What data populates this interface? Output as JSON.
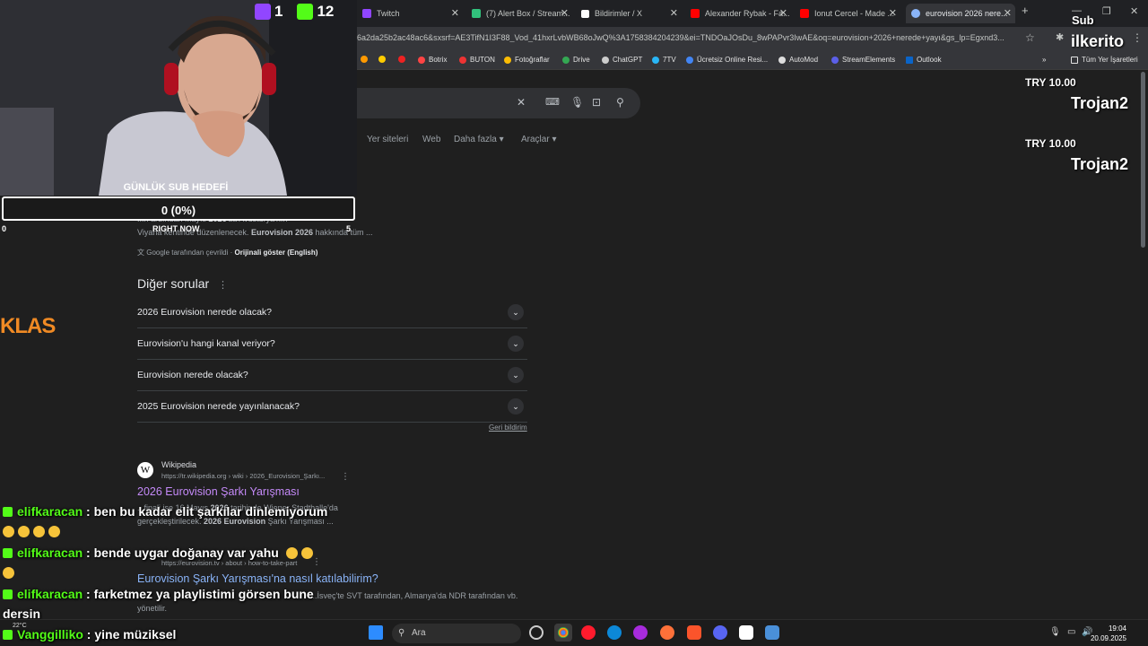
{
  "browser": {
    "tabs": [
      {
        "label": "Twitch",
        "color": "#9146ff"
      },
      {
        "label": "(7) Alert Box / Stream...",
        "color": "#31c27c"
      },
      {
        "label": "Bildirimler / X",
        "color": "#ffffff"
      },
      {
        "label": "Alexander Rybak - Fa...",
        "color": "#ff0000"
      },
      {
        "label": "Ionut Cercel - Made ...",
        "color": "#ff0000"
      },
      {
        "label": "eurovision 2026 nere...",
        "color": "#8ab4f8"
      }
    ],
    "new_tab": "+",
    "url": "6a2da25b2ac48ac6&sxsrf=AE3TifN1I3F88_Vod_41hxrLvbWB68oJwQ%3A1758384204239&ei=TNDOaJOsDu_8wPAPvr3IwAE&oq=eurovision+2026+nerede+yayı&gs_lp=Egxnd3...",
    "bookmarks": [
      {
        "label": "Botrix",
        "color": "#f44"
      },
      {
        "label": "BUTON",
        "color": "#e33"
      },
      {
        "label": "Fotoğraflar",
        "color": "#fbbc04"
      },
      {
        "label": "Drive",
        "color": "#34a853"
      },
      {
        "label": "ChatGPT",
        "color": "#ccc"
      },
      {
        "label": "7TV",
        "color": "#29b6f6"
      },
      {
        "label": "Ücretsiz Online Resi...",
        "color": "#4285f4"
      },
      {
        "label": "AutoMod",
        "color": "#ddd"
      },
      {
        "label": "StreamElements",
        "color": "#5b5fe8"
      },
      {
        "label": "Outlook",
        "color": "#0a64c8"
      }
    ],
    "bookmarks_all": "Tüm Yer İşaretleri"
  },
  "google": {
    "nav_tabs": [
      "Yer siteleri",
      "Web",
      "Daha fazla",
      "Araçlar"
    ],
    "snippet_line1_pre": "...n ardından Mayıs ",
    "snippet_line1_bold": "2026",
    "snippet_line1_post": "'da Avusturya'nın",
    "snippet_line2_pre": "Viyana kentinde düzenlenecek. ",
    "snippet_line2_bold": "Eurovision 2026",
    "snippet_line2_post": " hakkında tüm ...",
    "translated_by": "Google tarafından çevrildi",
    "show_original": "Orijinali göster (English)",
    "more_questions_title": "Diğer sorular",
    "questions": [
      "2026 Eurovision nerede olacak?",
      "Eurovision'u hangi kanal veriyor?",
      "Eurovision nerede olacak?",
      "2025 Eurovision nerede yayınlanacak?"
    ],
    "feedback": "Geri bildirim",
    "result1": {
      "site": "Wikipedia",
      "url": "https://tr.wikipedia.org › wiki › 2026_Eurovision_Şarkı...",
      "title": "2026 Eurovision Şarkı Yarışması",
      "snippet_pre": "...finali ise 16 Mayıs ",
      "snippet_bold": "2026",
      "snippet_post": " tarihinde Wiener Stadthalle'da",
      "snippet2_pre": "gerçekleştirilecek. ",
      "snippet2_bold": "2026 Eurovision",
      "snippet2_post": " Şarkı Yarışması ..."
    },
    "result2": {
      "url": "https://eurovision.tv › about › how-to-take-part",
      "title": "Eurovision Şarkı Yarışması'na nasıl katılabilirim?",
      "snippet": "...İsveç'te SVT tarafından, Almanya'da NDR tarafından vb.",
      "snippet2": "yönetilir."
    }
  },
  "overlay": {
    "twitch_count": "1",
    "kick_count": "12",
    "goal_title": "GÜNLÜK SUB HEDEFİ",
    "goal_text": "0 (0%)",
    "goal_progress": 0,
    "goal_min": "0",
    "goal_max": "5",
    "goal_now": "RIGHT NOW",
    "klas": "KLAS",
    "sub_label": "Sub",
    "sub_name": "ilkerito",
    "alerts": [
      {
        "price": "TRY 10.00",
        "name": "Trojan2"
      },
      {
        "price": "TRY 10.00",
        "name": "Trojan2"
      }
    ]
  },
  "chat": [
    {
      "user": "elifkaracan",
      "text": "ben bu kadar elit şarkılar dinlemiyorum",
      "emotes": 4
    },
    {
      "user": "elifkaracan",
      "text": "bende uygar doğanay var yahu",
      "emotes": 0
    },
    {
      "user": "elifkaracan",
      "text": "farketmez ya playlistimi görsen bune",
      "cont": "dersin"
    },
    {
      "user": "Vanggilliko",
      "text": "yine müziksel"
    }
  ],
  "taskbar": {
    "weather": "22°C",
    "search": "Ara",
    "time": "19:04",
    "date": "20.09.2025"
  }
}
